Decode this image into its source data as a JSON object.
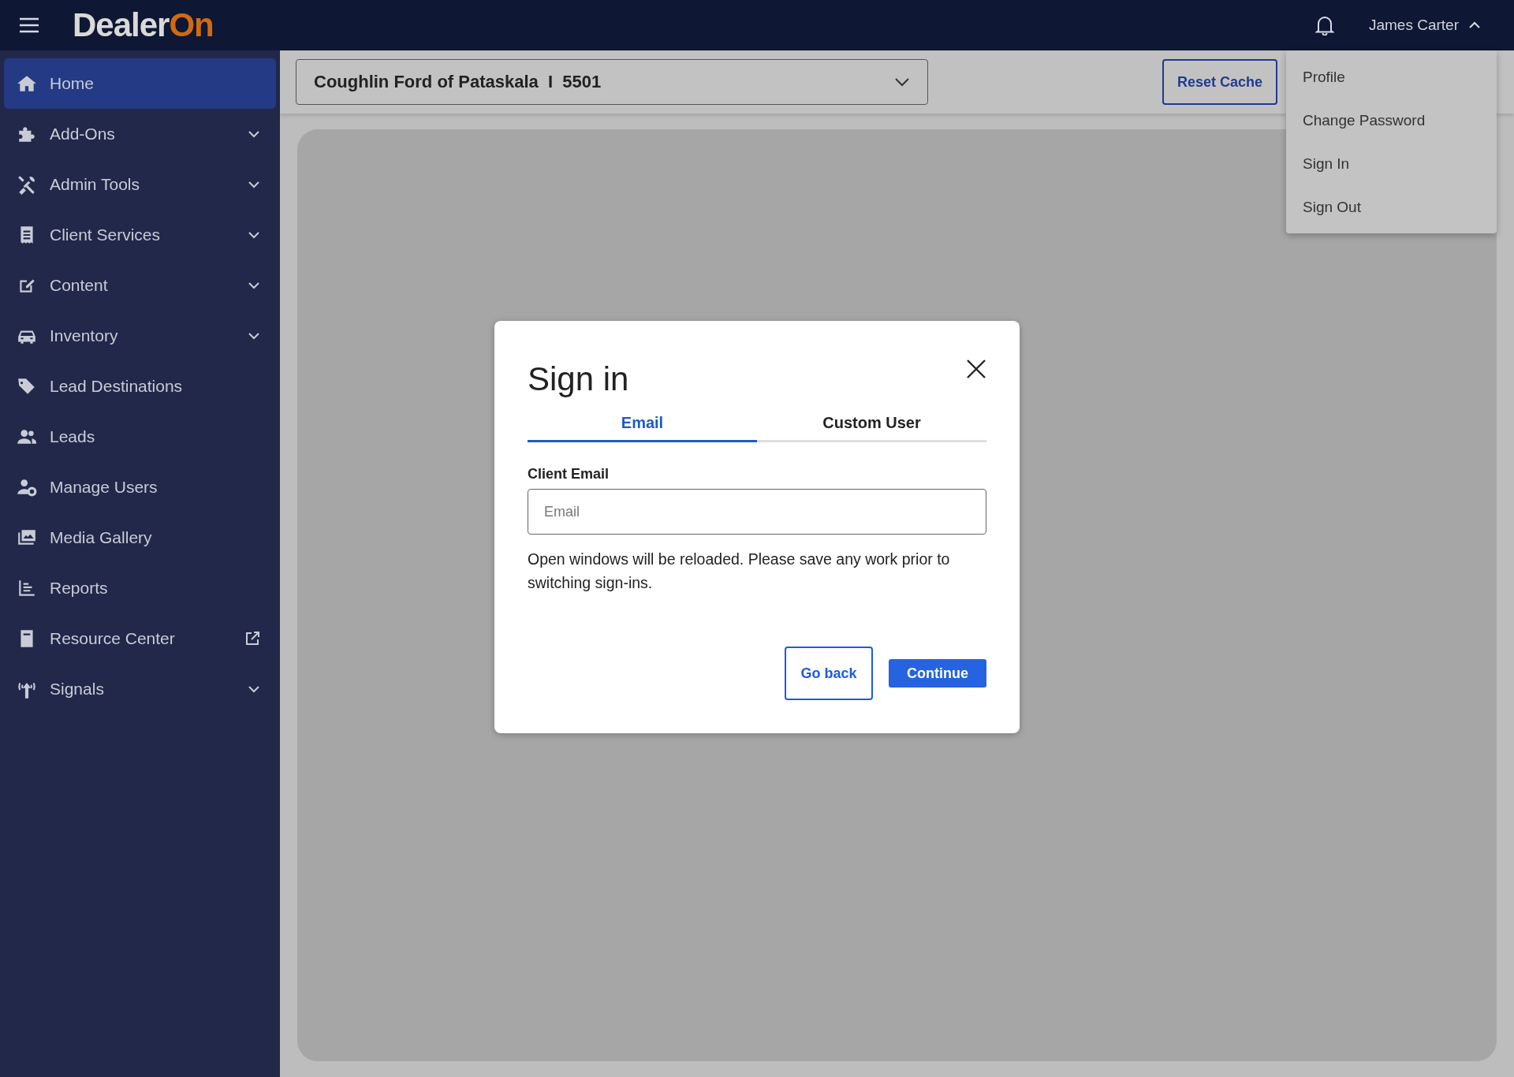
{
  "header": {
    "logo": {
      "main": "Dealer",
      "accent": "On"
    },
    "user": {
      "name": "James Carter",
      "expanded": true
    }
  },
  "sidebar": {
    "items": [
      {
        "label": "Home",
        "selected": true,
        "kind": "plain"
      },
      {
        "label": "Add-Ons",
        "selected": false,
        "kind": "expandable"
      },
      {
        "label": "Admin Tools",
        "selected": false,
        "kind": "expandable"
      },
      {
        "label": "Client Services",
        "selected": false,
        "kind": "expandable"
      },
      {
        "label": "Content",
        "selected": false,
        "kind": "expandable"
      },
      {
        "label": "Inventory",
        "selected": false,
        "kind": "expandable"
      },
      {
        "label": "Lead Destinations",
        "selected": false,
        "kind": "plain"
      },
      {
        "label": "Leads",
        "selected": false,
        "kind": "plain"
      },
      {
        "label": "Manage Users",
        "selected": false,
        "kind": "plain"
      },
      {
        "label": "Media Gallery",
        "selected": false,
        "kind": "plain"
      },
      {
        "label": "Reports",
        "selected": false,
        "kind": "plain"
      },
      {
        "label": "Resource Center",
        "selected": false,
        "kind": "external"
      },
      {
        "label": "Signals",
        "selected": false,
        "kind": "expandable"
      }
    ]
  },
  "toolbar": {
    "dealer_select": "Coughlin Ford of Pataskala  I  5501",
    "reset_button": "Reset Cache"
  },
  "user_menu": {
    "items": [
      "Profile",
      "Change Password",
      "Sign In",
      "Sign Out"
    ]
  },
  "modal": {
    "title": "Sign in",
    "tabs": [
      {
        "label": "Email",
        "selected": true
      },
      {
        "label": "Custom User",
        "selected": false
      }
    ],
    "field_label": "Client Email",
    "placeholder": "Email",
    "note": "Open windows will be reloaded. Please save any work prior to switching sign-ins.",
    "buttons": {
      "secondary": "Go back",
      "primary": "Continue"
    }
  }
}
